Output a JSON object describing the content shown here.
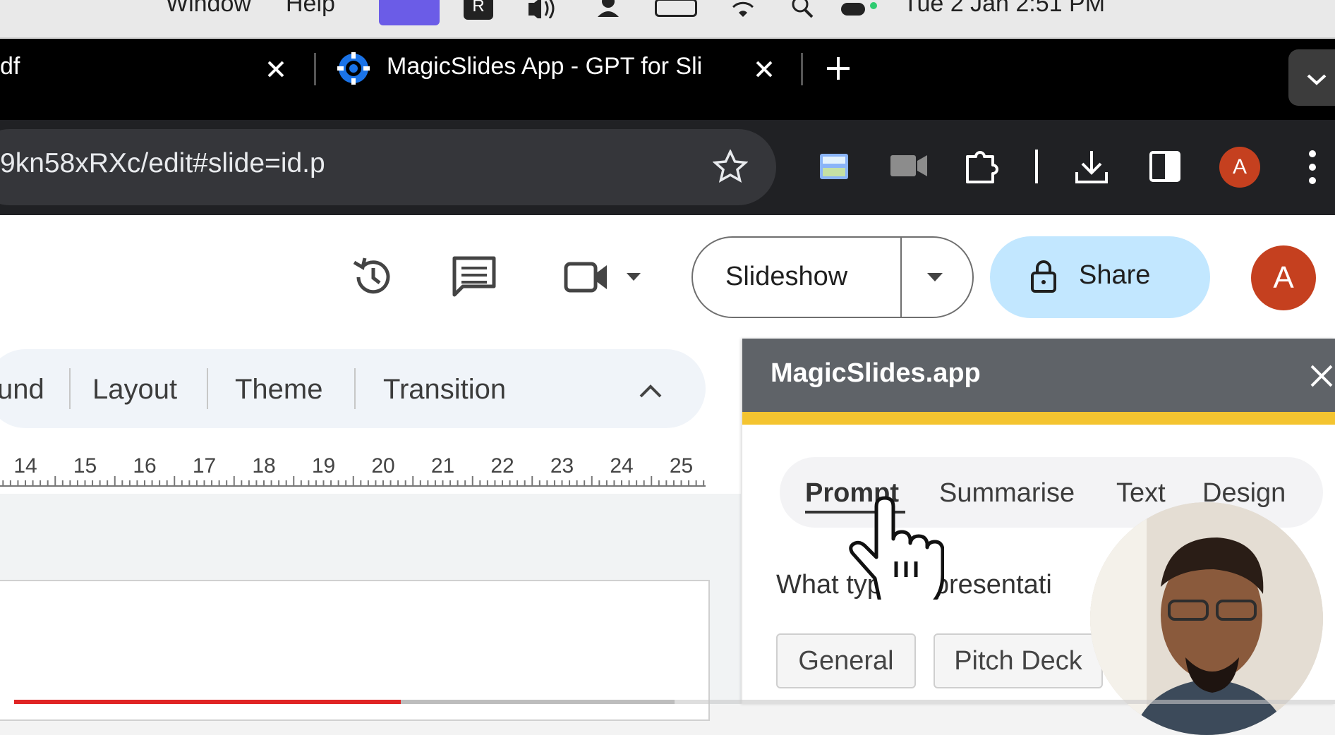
{
  "menubar": {
    "items": [
      "Window",
      "Help"
    ],
    "clock": "Tue 2 Jan  2:51 PM"
  },
  "browser": {
    "tabs": [
      {
        "title": "df"
      },
      {
        "title": "MagicSlides App - GPT for Sli"
      }
    ],
    "url": "9kn58xRXc/edit#slide=id.p",
    "profile_initial": "A"
  },
  "slides": {
    "slideshow_label": "Slideshow",
    "share_label": "Share",
    "account_initial": "A",
    "toolbar": [
      "und",
      "Layout",
      "Theme",
      "Transition"
    ],
    "ruler": [
      "14",
      "15",
      "16",
      "17",
      "18",
      "19",
      "20",
      "21",
      "22",
      "23",
      "24",
      "25"
    ]
  },
  "panel": {
    "title": "MagicSlides.app",
    "tabs": [
      "Prompt",
      "Summarise",
      "Text",
      "Design"
    ],
    "active_tab": "Prompt",
    "question": "What type of presentati",
    "chips": [
      "General",
      "Pitch Deck"
    ]
  },
  "video": {
    "progress": 0.293,
    "buffered": 0.5
  },
  "colors": {
    "accent_yellow": "#f4c430",
    "share_bg": "#c2e7ff",
    "avatar": "#c5401f",
    "progress": "#e02424"
  }
}
